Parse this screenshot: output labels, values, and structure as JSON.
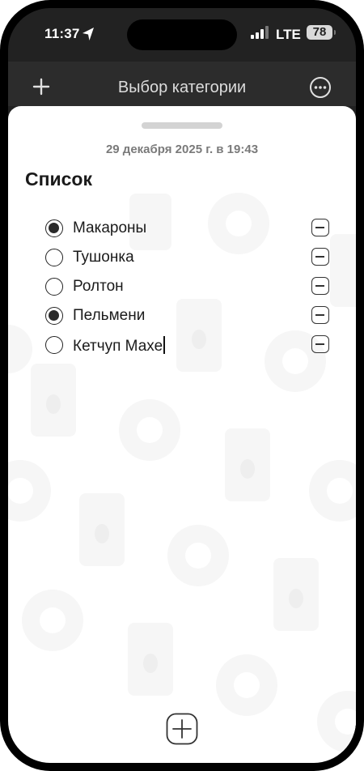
{
  "status_bar": {
    "time": "11:37",
    "network": "LTE",
    "battery": "78"
  },
  "nav": {
    "title": "Выбор категории",
    "add_icon": "plus-icon",
    "more_icon": "ellipsis-circle-icon"
  },
  "sheet": {
    "date": "29 декабря 2025 г. в 19:43",
    "title": "Список",
    "items": [
      {
        "label": "Макароны",
        "checked": true
      },
      {
        "label": "Тушонка",
        "checked": false
      },
      {
        "label": "Ролтон",
        "checked": false
      },
      {
        "label": "Пельмени",
        "checked": true
      },
      {
        "label": "Кетчуп Махе",
        "checked": false,
        "editing": true
      }
    ],
    "add_item_icon": "plus-square-icon"
  },
  "colors": {
    "background": "#222222",
    "sheet": "#ffffff",
    "text": "#1a1a1a",
    "date": "#7a7a7a"
  }
}
